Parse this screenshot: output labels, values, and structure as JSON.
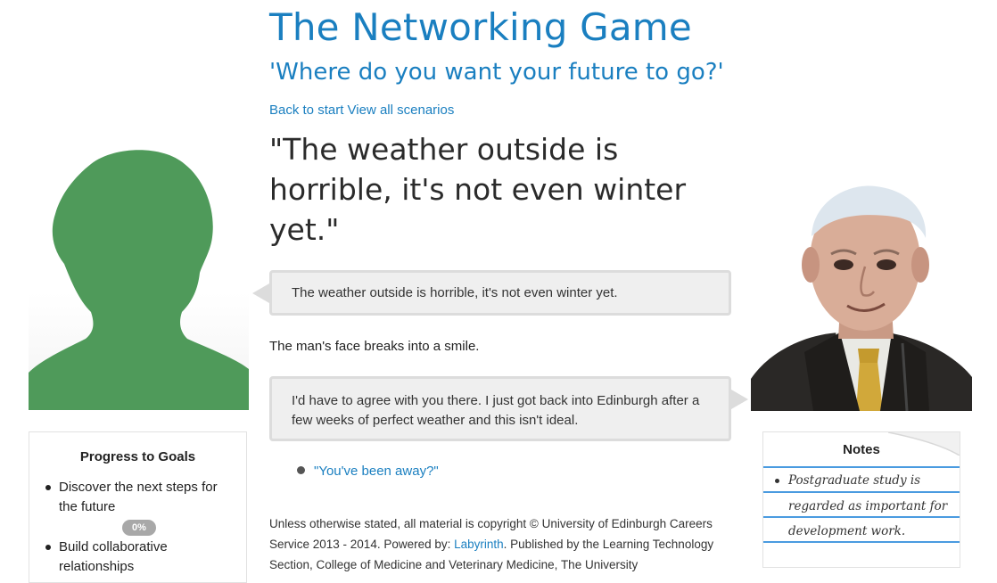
{
  "header": {
    "title": "The Networking Game",
    "subtitle": "'Where do you want your future to go?'"
  },
  "nav": {
    "back_label": "Back to start",
    "scenarios_label": "View all scenarios"
  },
  "scene": {
    "quote": "\"The weather outside is horrible, it's not even winter yet.\"",
    "player_line": "The weather outside is horrible, it's not even winter yet.",
    "narration": "The man's face breaks into a smile.",
    "npc_line": "I'd have to agree with you there. I just got back into Edinburgh after a few weeks of perfect weather and this isn't ideal.",
    "options": [
      "\"You've been away?\""
    ]
  },
  "footer": {
    "text_before": "Unless otherwise stated, all material is copyright © University of Edinburgh Careers Service 2013 - 2014. Powered by: ",
    "link_label": "Labyrinth",
    "text_after": ". Published by the Learning Technology Section, College of Medicine and Veterinary Medicine, The University"
  },
  "progress": {
    "title": "Progress to Goals",
    "goals": [
      {
        "label": "Discover the next steps for the future",
        "percent": 0,
        "percent_label": "0%"
      },
      {
        "label": "Build collaborative relationships"
      }
    ]
  },
  "notes": {
    "title": "Notes",
    "items": [
      "Postgraduate study is regarded as important for development work."
    ]
  },
  "colors": {
    "accent": "#1a7fc0",
    "silhouette": "#4f9a5a",
    "bubble_bg": "#efefef",
    "notes_line": "#4a9be0"
  }
}
